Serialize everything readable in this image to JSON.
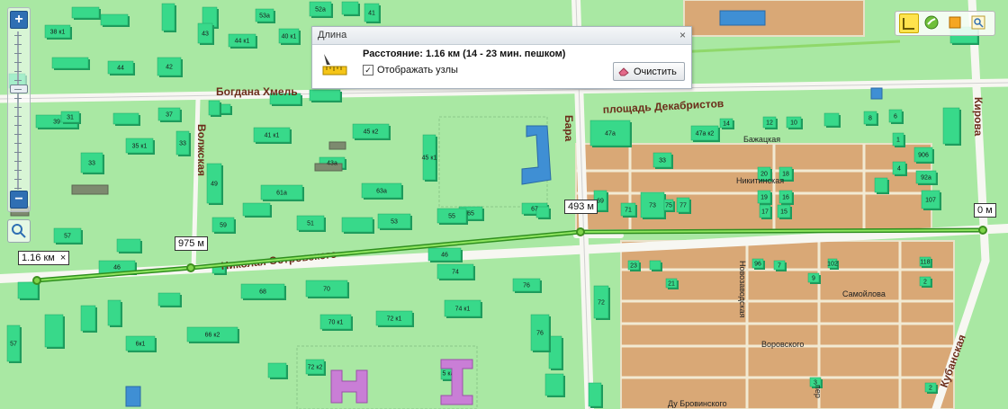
{
  "popup": {
    "title": "Длина",
    "close": "×",
    "distance_text": "Расстояние: 1.16 км (14 - 23 мин. пешком)",
    "show_nodes_label": "Отображать узлы",
    "show_nodes_checked": true,
    "clear_label": "Очистить"
  },
  "zoom": {
    "plus": "+",
    "minus": "−",
    "level_fraction": 0.35
  },
  "markers": {
    "start": "1.16 км",
    "start_close": "×",
    "m1": "975 м",
    "m2": "493 м",
    "end": "0 м"
  },
  "streets": {
    "bohdana": "Богдана Хмель",
    "decembrists": "площадь Декабристов",
    "volzhskaya": "Волжская",
    "bara": "Бара",
    "kirova": "Кирова",
    "ostrovskogo": "Николая Островского",
    "bazhatskaya": "Бажацкая",
    "nikitinskaya": "Никитинская",
    "samoylova": "Самойлова",
    "vorovskogo": "Воровского",
    "novozavodskaya": "Новозаводская",
    "kubanskaya": "Кубанская",
    "du_brovinskogo": "Ду Бровинского",
    "per": "пер"
  },
  "buildings": {
    "b38k1": "38 к1",
    "b44k1": "44 к1",
    "b40k1": "40 к1",
    "b44": "44",
    "b42": "42",
    "b43": "43",
    "b53a": "53а",
    "b52a": "52а",
    "b41": "41",
    "b39": "39",
    "b33": "33",
    "b37": "37",
    "b35k1": "35 к1",
    "b33b": "33",
    "b31": "31",
    "b41k1": "41 к1",
    "b45k2": "45 к2",
    "b43a": "43а",
    "b49": "49",
    "b61a": "61а",
    "b63a": "63а",
    "b45k1": "45 к1",
    "b47a": "47а",
    "b47ak2": "47а к2",
    "b14": "14",
    "b12": "12",
    "b10": "10",
    "b8": "8",
    "b6": "6",
    "b4": "4",
    "b1": "1",
    "b906": "906",
    "b92a": "92а",
    "b107": "107",
    "b23": "23",
    "b73": "73",
    "b75": "75",
    "b77": "77",
    "b71": "71",
    "b67": "67",
    "b65": "65",
    "b69": "69",
    "b59": "59",
    "b51": "51",
    "b53": "53",
    "b55": "55",
    "b57": "57",
    "b46": "46",
    "b68": "68",
    "b70": "70",
    "b72k1": "72 к1",
    "b74k1": "74 к1",
    "b74": "74",
    "b76": "76",
    "b72": "72",
    "b70k1": "70 к1",
    "b66k2": "66 к2",
    "b6k1": "6к1",
    "b72k2": "72 к2",
    "b5ka": "5 ка",
    "b21": "21",
    "b19": "19",
    "b17": "17",
    "b15": "15",
    "b16": "16",
    "b18": "18",
    "b20": "20",
    "b7": "7",
    "b118": "118",
    "b102": "102",
    "b96": "96",
    "b3": "3",
    "b2": "2",
    "b9": "9"
  }
}
